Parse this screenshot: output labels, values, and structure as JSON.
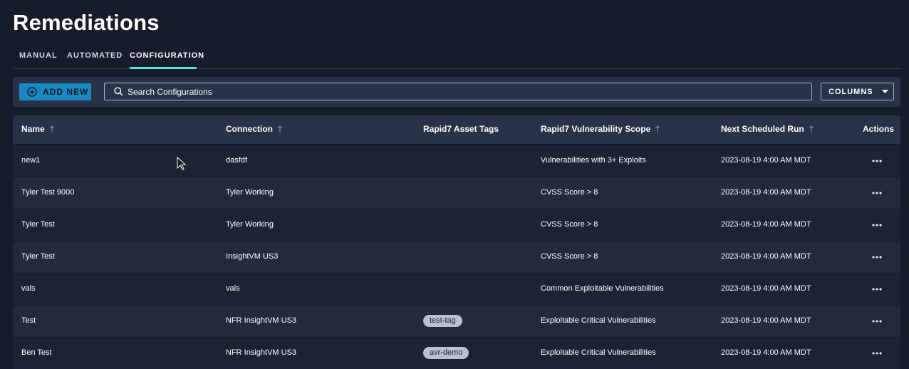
{
  "page": {
    "title": "Remediations"
  },
  "tabs": [
    {
      "label": "MANUAL",
      "active": false
    },
    {
      "label": "AUTOMATED",
      "active": false
    },
    {
      "label": "CONFIGURATION",
      "active": true
    }
  ],
  "toolbar": {
    "add_new_label": "ADD NEW",
    "search_placeholder": "Search Configurations",
    "search_value": "",
    "columns_label": "COLUMNS"
  },
  "table": {
    "columns": [
      {
        "label": "Name",
        "sortable": true
      },
      {
        "label": "Connection",
        "sortable": true
      },
      {
        "label": "Rapid7 Asset Tags",
        "sortable": false
      },
      {
        "label": "Rapid7 Vulnerability Scope",
        "sortable": true
      },
      {
        "label": "Next Scheduled Run",
        "sortable": true
      },
      {
        "label": "Actions",
        "sortable": false
      }
    ],
    "rows": [
      {
        "name": "new1",
        "connection": "dasfdf",
        "tag": "",
        "scope": "Vulnerabilities with 3+ Exploits",
        "next_run": "2023-08-19 4:00 AM MDT"
      },
      {
        "name": "Tyler Test 9000",
        "connection": "Tyler Working",
        "tag": "",
        "scope": "CVSS Score > 8",
        "next_run": "2023-08-19 4:00 AM MDT"
      },
      {
        "name": "Tyler Test",
        "connection": "Tyler Working",
        "tag": "",
        "scope": "CVSS Score > 8",
        "next_run": "2023-08-19 4:00 AM MDT"
      },
      {
        "name": "Tyler Test",
        "connection": "InsightVM US3",
        "tag": "",
        "scope": "CVSS Score > 8",
        "next_run": "2023-08-19 4:00 AM MDT"
      },
      {
        "name": "vals",
        "connection": "vals",
        "tag": "",
        "scope": "Common Exploitable Vulnerabilities",
        "next_run": "2023-08-19 4:00 AM MDT"
      },
      {
        "name": "Test",
        "connection": "NFR InsightVM US3",
        "tag": "test-tag",
        "scope": "Exploitable Critical Vulnerabilities",
        "next_run": "2023-08-19 4:00 AM MDT"
      },
      {
        "name": "Ben Test",
        "connection": "NFR InsightVM US3",
        "tag": "avr-demo",
        "scope": "Exploitable Critical Vulnerabilities",
        "next_run": "2023-08-19 4:00 AM MDT"
      }
    ]
  },
  "icons": {
    "add": "plus-circle-icon",
    "search": "search-icon",
    "columns": "chevron-down-icon",
    "sort": "sort-arrow-up-icon",
    "actions": "more-horizontal-icon",
    "cursor": "mouse-pointer-icon"
  },
  "colors": {
    "background": "#161c2a",
    "panel": "#283248",
    "accent": "#4ee0e2",
    "primary_button": "#1b88c2",
    "tag": "#b9c2d0"
  }
}
